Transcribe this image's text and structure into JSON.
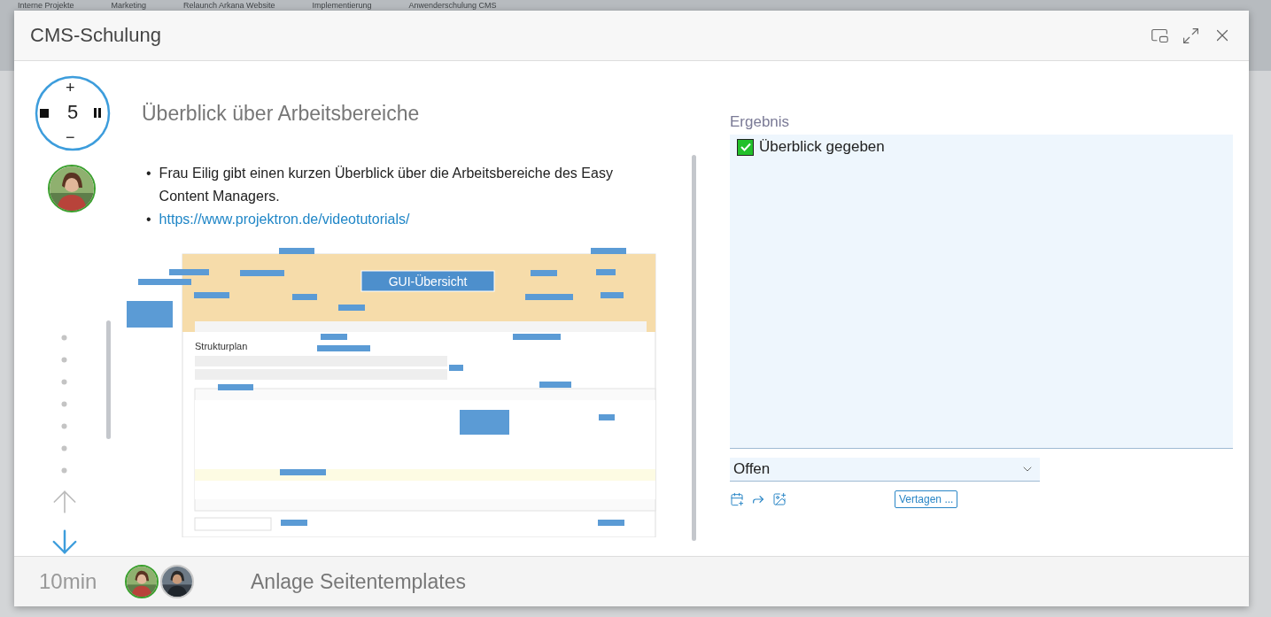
{
  "background": {
    "tabs": [
      "Interne Projekte",
      "Marketing",
      "Relaunch Arkana Website",
      "Implementierung",
      "Anwenderschulung CMS"
    ]
  },
  "dialog": {
    "title": "CMS-Schulung"
  },
  "timer": {
    "value": "5",
    "increase": "+",
    "decrease": "−"
  },
  "presenter": {
    "highlighted": true
  },
  "agenda": {
    "title": "Überblick über Arbeitsbereiche",
    "bullets": [
      {
        "kind": "text",
        "marker": "•",
        "text": "Frau Eilig gibt einen kurzen Überblick über die Arbeitsbereiche des Easy Content Managers."
      },
      {
        "kind": "link",
        "marker": "•",
        "text": "https://www.projektron.de/videotutorials/"
      }
    ]
  },
  "screenshot": {
    "kind": "picture",
    "banner": "GUI-Übersicht",
    "view": "Strukturplan"
  },
  "result": {
    "label": "Ergebnis",
    "items": [
      {
        "text": "Überblick gegeben",
        "checked": true
      }
    ]
  },
  "status_select": {
    "value": "Offen"
  },
  "postpone_button": "Vertagen ...",
  "footer": {
    "duration": "10min",
    "attendees": [
      {
        "highlighted": true
      },
      {
        "highlighted": false
      }
    ],
    "next_title": "Anlage Seitentemplates"
  }
}
